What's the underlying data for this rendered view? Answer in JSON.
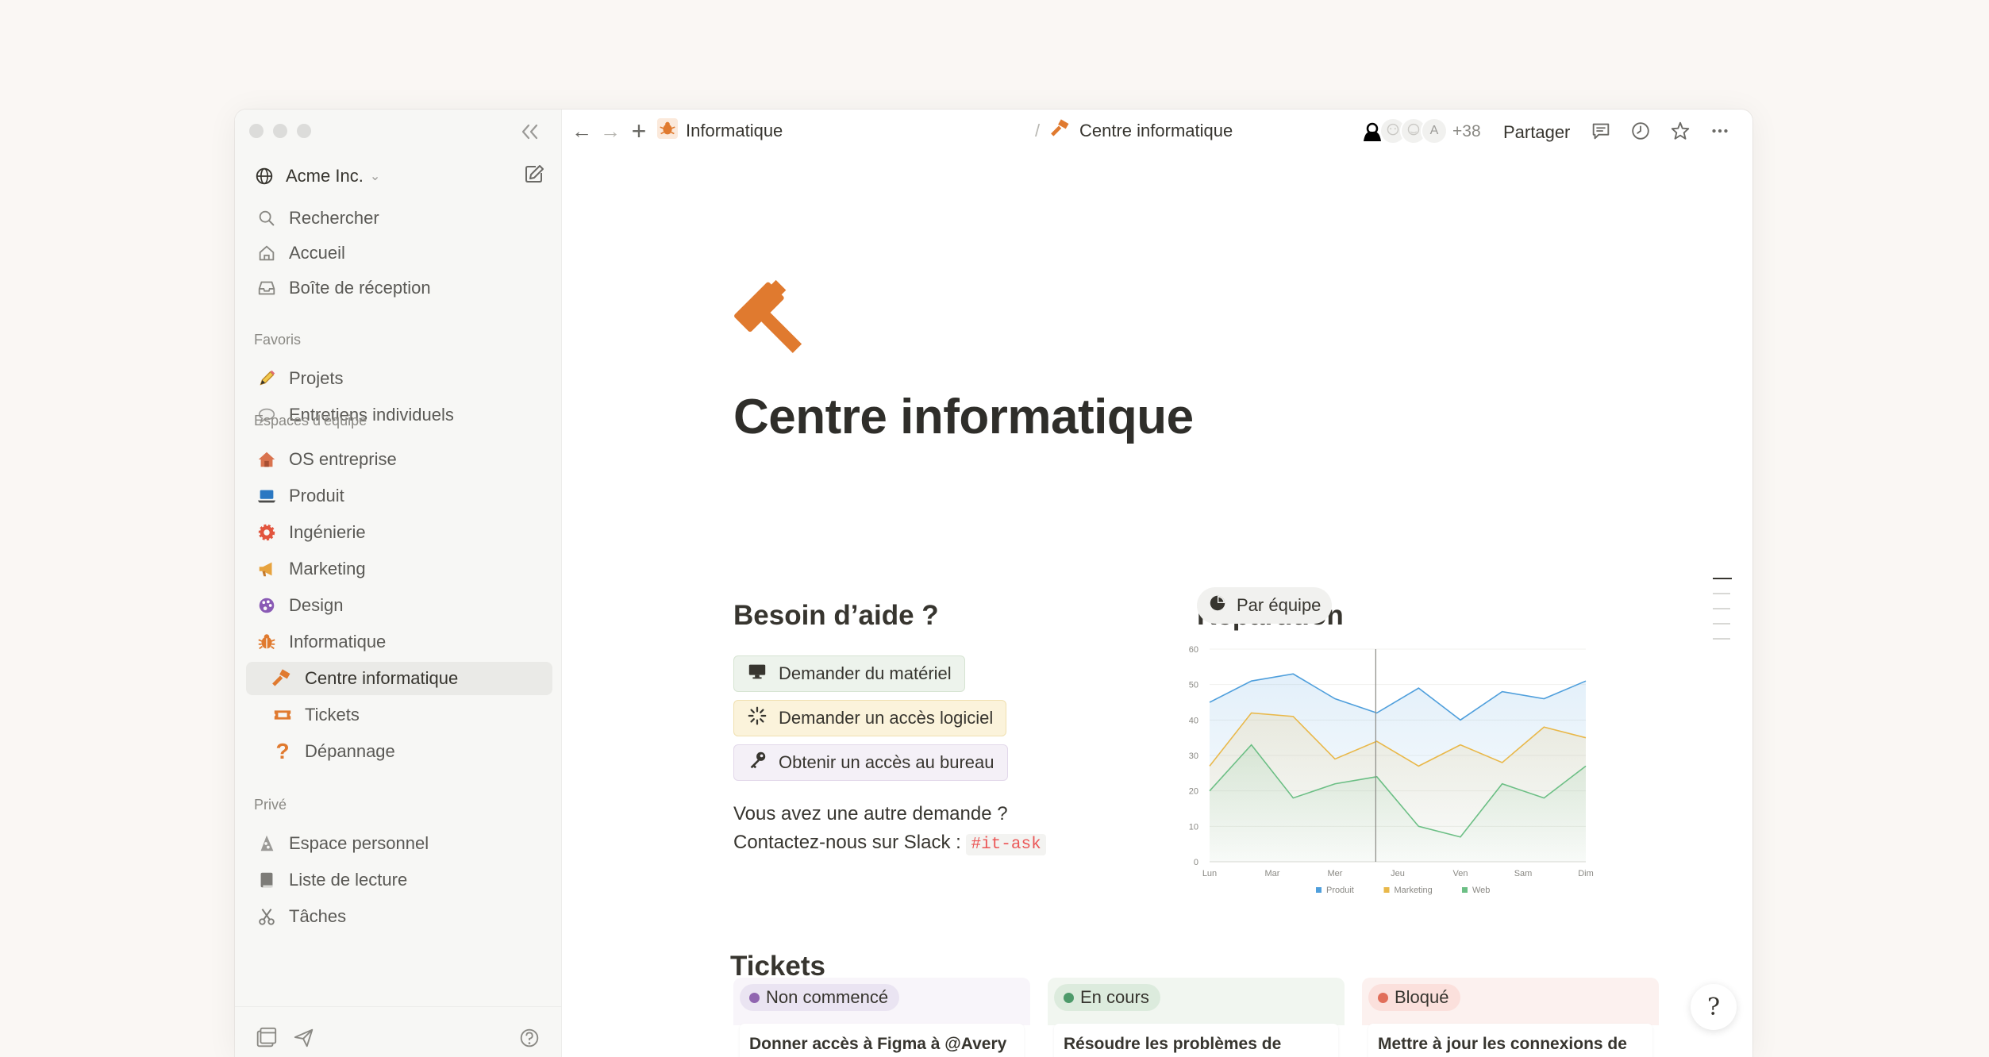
{
  "sidebar": {
    "workspace_name": "Acme Inc.",
    "nav": [
      {
        "label": "Rechercher",
        "icon": "search-icon"
      },
      {
        "label": "Accueil",
        "icon": "home-icon"
      },
      {
        "label": "Boîte de réception",
        "icon": "inbox-icon"
      }
    ],
    "favorites_label": "Favoris",
    "favorites": [
      {
        "label": "Projets",
        "icon": "pencil-icon"
      },
      {
        "label": "Entretiens individuels",
        "icon": "speech-bubble-icon"
      }
    ],
    "teamspaces_label": "Espaces d’équipe",
    "teamspaces": [
      {
        "label": "OS entreprise",
        "icon": "house-icon"
      },
      {
        "label": "Produit",
        "icon": "laptop-icon"
      },
      {
        "label": "Ingénierie",
        "icon": "gear-icon"
      },
      {
        "label": "Marketing",
        "icon": "megaphone-icon"
      },
      {
        "label": "Design",
        "icon": "palette-icon"
      },
      {
        "label": "Informatique",
        "icon": "bug-icon"
      },
      {
        "label": "Centre informatique",
        "icon": "hammer-icon"
      },
      {
        "label": "Tickets",
        "icon": "ticket-icon"
      },
      {
        "label": "Dépannage",
        "icon": "question-icon"
      }
    ],
    "private_label": "Privé",
    "private": [
      {
        "label": "Espace personnel",
        "icon": "pizza-icon"
      },
      {
        "label": "Liste de lecture",
        "icon": "book-icon"
      },
      {
        "label": "Tâches",
        "icon": "scissors-icon"
      }
    ]
  },
  "topbar": {
    "breadcrumb_parent": "Informatique",
    "breadcrumb_current": "Centre informatique",
    "avatar_letter": "A",
    "more_count": "+38",
    "share_label": "Partager"
  },
  "page": {
    "title": "Centre informatique",
    "help_heading": "Besoin d’aide ?",
    "actions": [
      {
        "label": "Demander du matériel",
        "icon": "monitor-icon",
        "color": "#edf3ec"
      },
      {
        "label": "Demander un accès logiciel",
        "icon": "loading-sparkle-icon",
        "color": "#fbf3db"
      },
      {
        "label": "Obtenir un accès au bureau",
        "icon": "key-icon",
        "color": "#f4f0f7"
      }
    ],
    "other_request": "Vous avez une autre demande ?",
    "contact_prefix": "Contactez-nous sur Slack : ",
    "slack_channel": "#it-ask",
    "breakdown_heading": "Répartition",
    "breakdown_filter": "Par équipe",
    "tickets_heading": "Tickets",
    "ticket_columns": [
      {
        "status": "Non commencé",
        "dot_color": "#9065b0",
        "pill_bg": "#eae4f2",
        "card_title": "Donner accès à Figma à @Avery"
      },
      {
        "status": "En cours",
        "dot_color": "#4d9a6a",
        "pill_bg": "#dcebdd",
        "card_title": "Résoudre les problèmes de"
      },
      {
        "status": "Bloqué",
        "dot_color": "#e16e5a",
        "pill_bg": "#fbe0dc",
        "card_title": "Mettre à jour les connexions de"
      }
    ]
  },
  "chart_data": {
    "type": "area",
    "categories": [
      "Lun",
      "Mar",
      "Mer",
      "Jeu",
      "Ven",
      "Sam",
      "Dim"
    ],
    "x_points": [
      0,
      0.5,
      1,
      1.5,
      2,
      2.5,
      3,
      3.5,
      4,
      4.5,
      5,
      5.5,
      6
    ],
    "ylim": [
      0,
      60
    ],
    "yticks": [
      0,
      10,
      20,
      30,
      40,
      50,
      60
    ],
    "grid": true,
    "legend_position": "bottom",
    "crosshair_at": 2.65,
    "series": [
      {
        "name": "Produit",
        "color": "#4f9fdc",
        "values": [
          45,
          51,
          53,
          46,
          42,
          49,
          40,
          48,
          46,
          51
        ]
      },
      {
        "name": "Marketing",
        "color": "#e9b84a",
        "values": [
          27,
          42,
          41,
          29,
          34,
          27,
          33,
          28,
          38,
          35
        ]
      },
      {
        "name": "Web",
        "color": "#6cbf85",
        "values": [
          20,
          33,
          18,
          22,
          24,
          10,
          7,
          22,
          18,
          27
        ]
      }
    ]
  }
}
